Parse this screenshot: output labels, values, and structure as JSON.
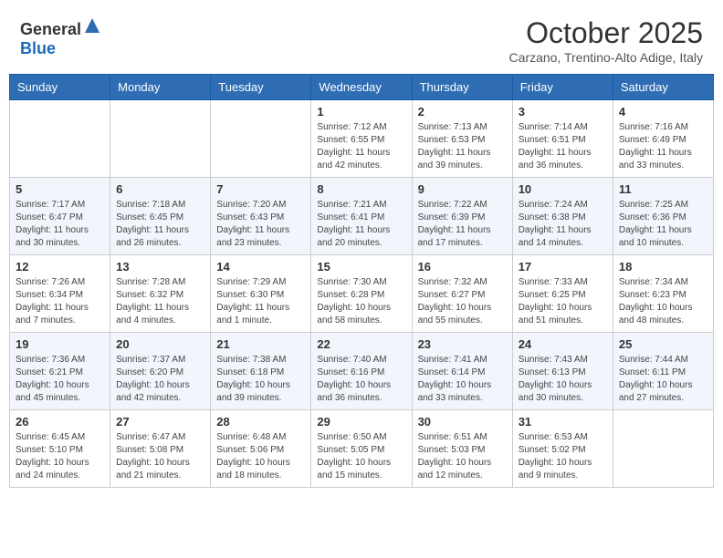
{
  "header": {
    "logo_general": "General",
    "logo_blue": "Blue",
    "month": "October 2025",
    "location": "Carzano, Trentino-Alto Adige, Italy"
  },
  "days_of_week": [
    "Sunday",
    "Monday",
    "Tuesday",
    "Wednesday",
    "Thursday",
    "Friday",
    "Saturday"
  ],
  "weeks": [
    [
      {
        "day": "",
        "content": ""
      },
      {
        "day": "",
        "content": ""
      },
      {
        "day": "",
        "content": ""
      },
      {
        "day": "1",
        "content": "Sunrise: 7:12 AM\nSunset: 6:55 PM\nDaylight: 11 hours and 42 minutes."
      },
      {
        "day": "2",
        "content": "Sunrise: 7:13 AM\nSunset: 6:53 PM\nDaylight: 11 hours and 39 minutes."
      },
      {
        "day": "3",
        "content": "Sunrise: 7:14 AM\nSunset: 6:51 PM\nDaylight: 11 hours and 36 minutes."
      },
      {
        "day": "4",
        "content": "Sunrise: 7:16 AM\nSunset: 6:49 PM\nDaylight: 11 hours and 33 minutes."
      }
    ],
    [
      {
        "day": "5",
        "content": "Sunrise: 7:17 AM\nSunset: 6:47 PM\nDaylight: 11 hours and 30 minutes."
      },
      {
        "day": "6",
        "content": "Sunrise: 7:18 AM\nSunset: 6:45 PM\nDaylight: 11 hours and 26 minutes."
      },
      {
        "day": "7",
        "content": "Sunrise: 7:20 AM\nSunset: 6:43 PM\nDaylight: 11 hours and 23 minutes."
      },
      {
        "day": "8",
        "content": "Sunrise: 7:21 AM\nSunset: 6:41 PM\nDaylight: 11 hours and 20 minutes."
      },
      {
        "day": "9",
        "content": "Sunrise: 7:22 AM\nSunset: 6:39 PM\nDaylight: 11 hours and 17 minutes."
      },
      {
        "day": "10",
        "content": "Sunrise: 7:24 AM\nSunset: 6:38 PM\nDaylight: 11 hours and 14 minutes."
      },
      {
        "day": "11",
        "content": "Sunrise: 7:25 AM\nSunset: 6:36 PM\nDaylight: 11 hours and 10 minutes."
      }
    ],
    [
      {
        "day": "12",
        "content": "Sunrise: 7:26 AM\nSunset: 6:34 PM\nDaylight: 11 hours and 7 minutes."
      },
      {
        "day": "13",
        "content": "Sunrise: 7:28 AM\nSunset: 6:32 PM\nDaylight: 11 hours and 4 minutes."
      },
      {
        "day": "14",
        "content": "Sunrise: 7:29 AM\nSunset: 6:30 PM\nDaylight: 11 hours and 1 minute."
      },
      {
        "day": "15",
        "content": "Sunrise: 7:30 AM\nSunset: 6:28 PM\nDaylight: 10 hours and 58 minutes."
      },
      {
        "day": "16",
        "content": "Sunrise: 7:32 AM\nSunset: 6:27 PM\nDaylight: 10 hours and 55 minutes."
      },
      {
        "day": "17",
        "content": "Sunrise: 7:33 AM\nSunset: 6:25 PM\nDaylight: 10 hours and 51 minutes."
      },
      {
        "day": "18",
        "content": "Sunrise: 7:34 AM\nSunset: 6:23 PM\nDaylight: 10 hours and 48 minutes."
      }
    ],
    [
      {
        "day": "19",
        "content": "Sunrise: 7:36 AM\nSunset: 6:21 PM\nDaylight: 10 hours and 45 minutes."
      },
      {
        "day": "20",
        "content": "Sunrise: 7:37 AM\nSunset: 6:20 PM\nDaylight: 10 hours and 42 minutes."
      },
      {
        "day": "21",
        "content": "Sunrise: 7:38 AM\nSunset: 6:18 PM\nDaylight: 10 hours and 39 minutes."
      },
      {
        "day": "22",
        "content": "Sunrise: 7:40 AM\nSunset: 6:16 PM\nDaylight: 10 hours and 36 minutes."
      },
      {
        "day": "23",
        "content": "Sunrise: 7:41 AM\nSunset: 6:14 PM\nDaylight: 10 hours and 33 minutes."
      },
      {
        "day": "24",
        "content": "Sunrise: 7:43 AM\nSunset: 6:13 PM\nDaylight: 10 hours and 30 minutes."
      },
      {
        "day": "25",
        "content": "Sunrise: 7:44 AM\nSunset: 6:11 PM\nDaylight: 10 hours and 27 minutes."
      }
    ],
    [
      {
        "day": "26",
        "content": "Sunrise: 6:45 AM\nSunset: 5:10 PM\nDaylight: 10 hours and 24 minutes."
      },
      {
        "day": "27",
        "content": "Sunrise: 6:47 AM\nSunset: 5:08 PM\nDaylight: 10 hours and 21 minutes."
      },
      {
        "day": "28",
        "content": "Sunrise: 6:48 AM\nSunset: 5:06 PM\nDaylight: 10 hours and 18 minutes."
      },
      {
        "day": "29",
        "content": "Sunrise: 6:50 AM\nSunset: 5:05 PM\nDaylight: 10 hours and 15 minutes."
      },
      {
        "day": "30",
        "content": "Sunrise: 6:51 AM\nSunset: 5:03 PM\nDaylight: 10 hours and 12 minutes."
      },
      {
        "day": "31",
        "content": "Sunrise: 6:53 AM\nSunset: 5:02 PM\nDaylight: 10 hours and 9 minutes."
      },
      {
        "day": "",
        "content": ""
      }
    ]
  ]
}
